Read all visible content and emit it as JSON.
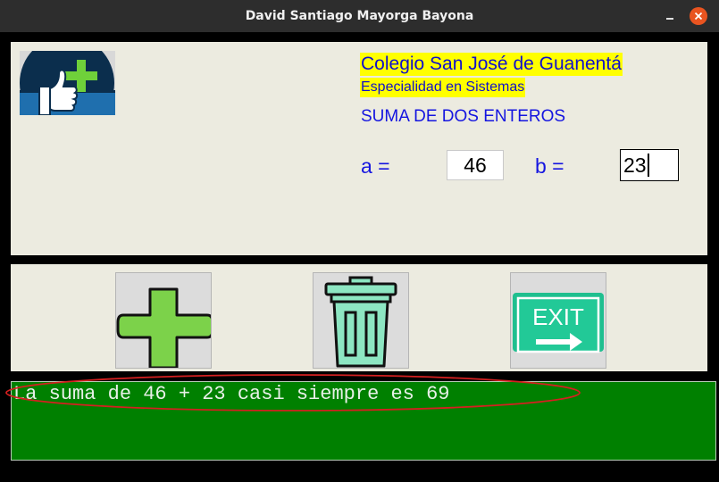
{
  "window": {
    "title": "David Santiago Mayorga Bayona"
  },
  "header": {
    "school": "Colegio San José de Guanentá",
    "specialty": "Especialidad en Sistemas",
    "heading": "SUMA DE DOS ENTEROS"
  },
  "form": {
    "a_label": "a =",
    "a_value": "46",
    "b_label": "b =",
    "b_value": "23"
  },
  "buttons": {
    "add_icon": "plus-icon",
    "clear_icon": "trash-icon",
    "exit_icon": "exit-sign-icon",
    "exit_sign_text": "EXIT"
  },
  "result": {
    "text": "La suma de 46 + 23 casi siempre es 69"
  },
  "colors": {
    "highlight": "#ffff00",
    "label_blue": "#1515e0",
    "result_bg": "#008000",
    "annotation_red": "#d42020",
    "close_orange": "#e95420"
  }
}
